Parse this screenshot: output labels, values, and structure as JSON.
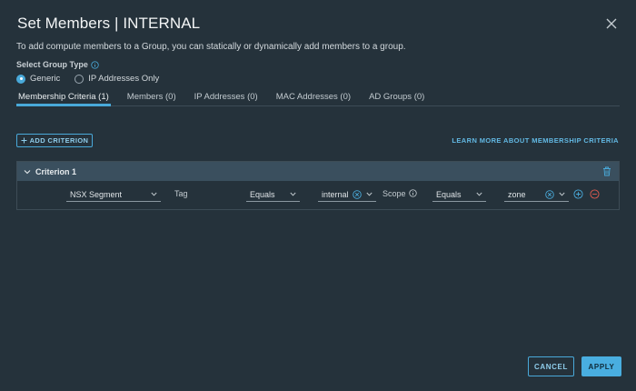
{
  "dialog": {
    "title": "Set Members | INTERNAL",
    "intro": "To add compute members to a Group, you can statically or dynamically add members to a group."
  },
  "group_type": {
    "label": "Select Group Type",
    "options": [
      {
        "label": "Generic",
        "selected": true
      },
      {
        "label": "IP Addresses Only",
        "selected": false
      }
    ]
  },
  "tabs": [
    {
      "label": "Membership Criteria (1)",
      "active": true
    },
    {
      "label": "Members (0)",
      "active": false
    },
    {
      "label": "IP Addresses (0)",
      "active": false
    },
    {
      "label": "MAC Addresses (0)",
      "active": false
    },
    {
      "label": "AD Groups (0)",
      "active": false
    }
  ],
  "toolbar": {
    "add_criterion": "ADD CRITERION",
    "learn_more": "LEARN MORE ABOUT MEMBERSHIP CRITERIA"
  },
  "criterion": {
    "title": "Criterion 1",
    "member_type": "NSX Segment",
    "tag_label": "Tag",
    "tag_operator": "Equals",
    "tag_value": "internal",
    "scope_label": "Scope",
    "scope_operator": "Equals",
    "scope_value": "zone"
  },
  "footer": {
    "cancel": "CANCEL",
    "apply": "APPLY"
  },
  "colors": {
    "background": "#25323b",
    "accent": "#49a9d9",
    "criterion_header": "#3a4f5e",
    "remove_red": "#e05a4f"
  },
  "icons": [
    "close-icon",
    "info-icon",
    "plus-icon",
    "chevron-down-icon",
    "trash-icon",
    "clear-icon",
    "add-circle-icon",
    "remove-circle-icon"
  ]
}
